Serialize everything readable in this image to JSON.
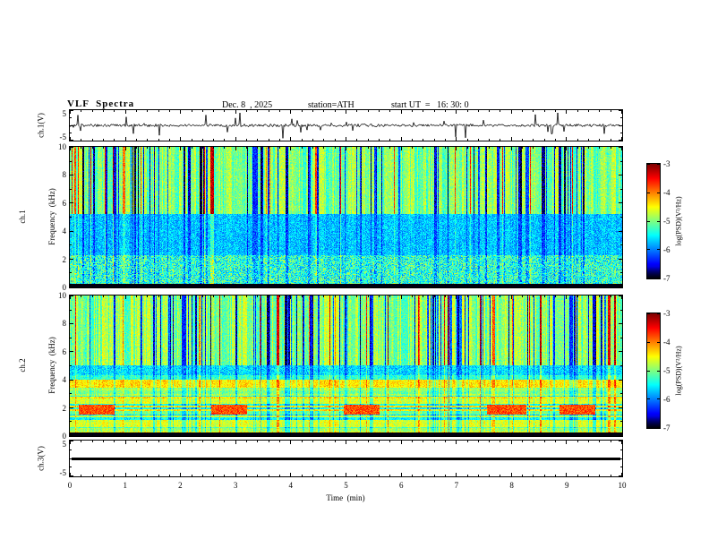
{
  "header": {
    "title": "VLF  Spectra",
    "date": "Dec. 8  , 2025",
    "station": "station=ATH",
    "start_ut": "start UT  =   16: 30: 0"
  },
  "axes": {
    "x": {
      "label": "Time  (min)",
      "ticks": [
        "0",
        "1",
        "2",
        "3",
        "4",
        "5",
        "6",
        "7",
        "8",
        "9",
        "10"
      ],
      "range": [
        0,
        10
      ]
    },
    "waveform_y": {
      "label": "ch.1(V)",
      "ticks": [
        "5",
        "-5"
      ],
      "range": [
        -5,
        5
      ]
    },
    "spec1_y": {
      "label_line1": "ch.1",
      "label_line2": "Frequency  (kHz)",
      "ticks": [
        "10",
        "8",
        "6",
        "4",
        "2",
        "0"
      ],
      "range": [
        0,
        10
      ]
    },
    "spec2_y": {
      "label_line1": "ch.2",
      "label_line2": "Frequency  (kHz)",
      "ticks": [
        "10",
        "8",
        "6",
        "4",
        "2",
        "0"
      ],
      "range": [
        0,
        10
      ]
    },
    "ch3_y": {
      "label": "ch.3(V)",
      "ticks": [
        "5",
        "-5"
      ],
      "range": [
        -5,
        5
      ]
    }
  },
  "colorbar": {
    "title": "log(PSD)(V²/Hz)",
    "ticks": [
      "-3",
      "-4",
      "-5",
      "-6",
      "-7"
    ],
    "range": [
      -7,
      -3
    ],
    "colormap": "jet"
  },
  "colors": {
    "frame": "#000000",
    "background": "#ffffff"
  },
  "chart_data": [
    {
      "id": "ch1_waveform",
      "type": "line",
      "title": "ch.1 raw signal",
      "ylabel": "ch.1(V)",
      "xlabel": "Time (min)",
      "xlim": [
        0,
        10
      ],
      "ylim": [
        -5,
        5
      ],
      "description": "Noisy broadband waveform centred near 0 V with dense impulsive sferic spikes reaching roughly ±4 V over the full 10 minutes",
      "noise_v": 0.45,
      "spike_prob": 0.05,
      "spike_v": 4.0
    },
    {
      "id": "ch1_spectrogram",
      "type": "heatmap",
      "ylabel": "ch.1 Frequency (kHz)",
      "xlabel": "Time (min)",
      "xlim": [
        0,
        10
      ],
      "ylim": [
        0,
        10
      ],
      "clim": [
        -7,
        -3
      ],
      "colormap": "jet",
      "colorbar_label": "log(PSD)(V²/Hz)",
      "description": "Mid-level green PSD above ~5 kHz crossed by dense vertical sferic streaks (dark-blue dropouts plus yellow/red enhancements); broad dark-blue low-PSD band from ~2.3-5.2 kHz; mixed cyan/green levels 0.2-2.3 kHz; near-black band at the lowest frequencies",
      "features": {
        "base_level": -5.0,
        "vertical_streaks": {
          "dark_prob": 0.17,
          "dark_level": -6.5,
          "bright_prob": 0.06,
          "bright_level": -3.6
        },
        "bands": [
          {
            "f0": 2.3,
            "f1": 5.2,
            "level": -6.05,
            "jitter": 0.45
          },
          {
            "f0": 0.22,
            "f1": 2.3,
            "level": -5.5,
            "jitter": 0.85
          }
        ],
        "black_below_khz": 0.22
      }
    },
    {
      "id": "ch2_spectrogram",
      "type": "heatmap",
      "ylabel": "ch.2 Frequency (kHz)",
      "xlabel": "Time (min)",
      "xlim": [
        0,
        10
      ],
      "ylim": [
        0,
        10
      ],
      "clim": [
        -7,
        -3
      ],
      "colormap": "jet",
      "colorbar_label": "log(PSD)(V²/Hz)",
      "description": "Green background with vertical sferic streaks above ~5 kHz; below 5 kHz a stack of narrow horizontal emission lines (alternating green/teal/yellow/dark-blue); recurring bright orange patches near 1.5-2.2 kHz; darker blue striping near 4.3-5 kHz; near-black band at the lowest frequencies",
      "features": {
        "base_level": -4.95,
        "vertical_streaks": {
          "dark_prob": 0.17,
          "dark_level": -6.4,
          "bright_prob": 0.06,
          "bright_level": -3.6
        },
        "horizontal_lines": {
          "below_khz": 5.0,
          "base": -5.0,
          "amp": 1.05,
          "change_prob": 0.45
        },
        "bands": [
          {
            "f0": 4.3,
            "f1": 5.05,
            "level": -5.9,
            "jitter": 0.5
          }
        ],
        "patches": [
          {
            "x0": 0.15,
            "x1": 0.8,
            "f0": 1.5,
            "f1": 2.2,
            "level": -3.8
          },
          {
            "x0": 2.55,
            "x1": 3.2,
            "f0": 1.5,
            "f1": 2.2,
            "level": -3.8
          },
          {
            "x0": 4.95,
            "x1": 5.6,
            "f0": 1.5,
            "f1": 2.2,
            "level": -3.8
          },
          {
            "x0": 7.55,
            "x1": 8.25,
            "f0": 1.5,
            "f1": 2.2,
            "level": -3.8
          },
          {
            "x0": 8.85,
            "x1": 9.5,
            "f0": 1.5,
            "f1": 2.2,
            "level": -3.8
          }
        ],
        "black_below_khz": 0.22
      }
    },
    {
      "id": "ch3_waveform",
      "type": "line",
      "title": "ch.3 raw signal",
      "ylabel": "ch.3(V)",
      "xlabel": "Time (min)",
      "xlim": [
        0,
        10
      ],
      "ylim": [
        -5,
        5
      ],
      "description": "Dead/flat channel: constant thick black trace at 0 V",
      "constant_v": 0
    }
  ]
}
